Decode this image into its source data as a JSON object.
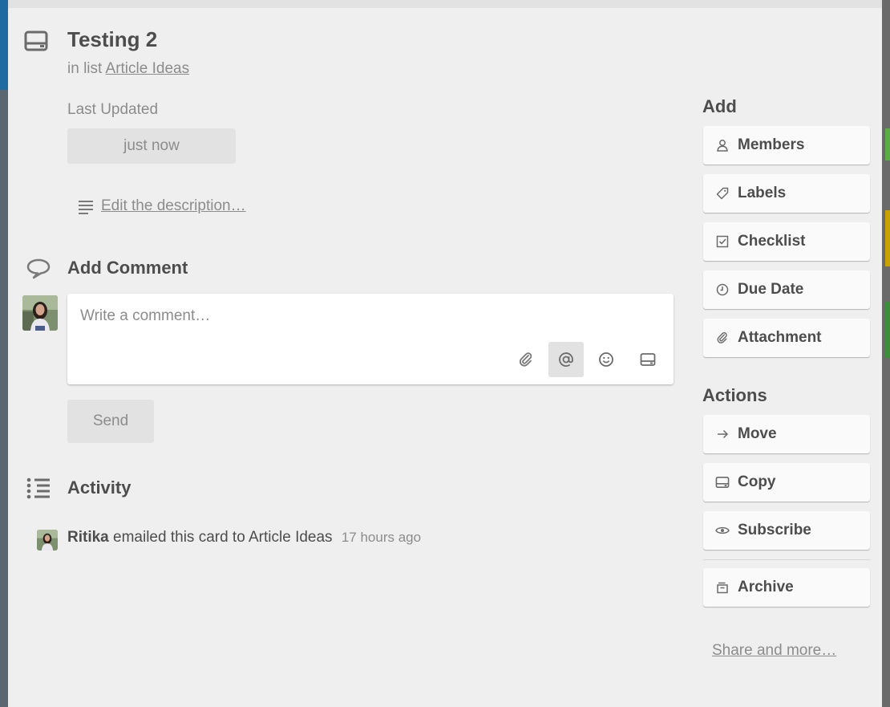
{
  "card": {
    "title": "Testing 2",
    "list_prefix": "in list",
    "list_name": "Article Ideas",
    "last_updated_label": "Last Updated",
    "last_updated_value": "just now",
    "edit_description": "Edit the description…"
  },
  "comment": {
    "heading": "Add Comment",
    "placeholder": "Write a comment…",
    "send_label": "Send",
    "toolbar_icons": [
      "paperclip-icon",
      "at-sign-icon",
      "smiley-icon",
      "card-icon"
    ]
  },
  "activity": {
    "heading": "Activity",
    "entries": [
      {
        "user": "Ritika",
        "text": "emailed this card to Article Ideas",
        "time": "17 hours ago"
      }
    ]
  },
  "sidebar": {
    "add_heading": "Add",
    "add_buttons": [
      {
        "label": "Members",
        "icon": "person-icon"
      },
      {
        "label": "Labels",
        "icon": "tag-icon"
      },
      {
        "label": "Checklist",
        "icon": "checkbox-icon"
      },
      {
        "label": "Due Date",
        "icon": "clock-icon"
      },
      {
        "label": "Attachment",
        "icon": "paperclip-icon"
      }
    ],
    "actions_heading": "Actions",
    "action_buttons": [
      {
        "label": "Move",
        "icon": "arrow-right-icon"
      },
      {
        "label": "Copy",
        "icon": "card-icon"
      },
      {
        "label": "Subscribe",
        "icon": "eye-icon"
      },
      {
        "label": "Archive",
        "icon": "archive-icon"
      }
    ],
    "share_link": "Share and more…"
  },
  "colors": {
    "modal_bg": "#efefef",
    "text_dark": "#4d4d4d",
    "text_muted": "#8c8c8c",
    "button_bg": "#fafafa",
    "disabled_bg": "#e2e2e2"
  }
}
